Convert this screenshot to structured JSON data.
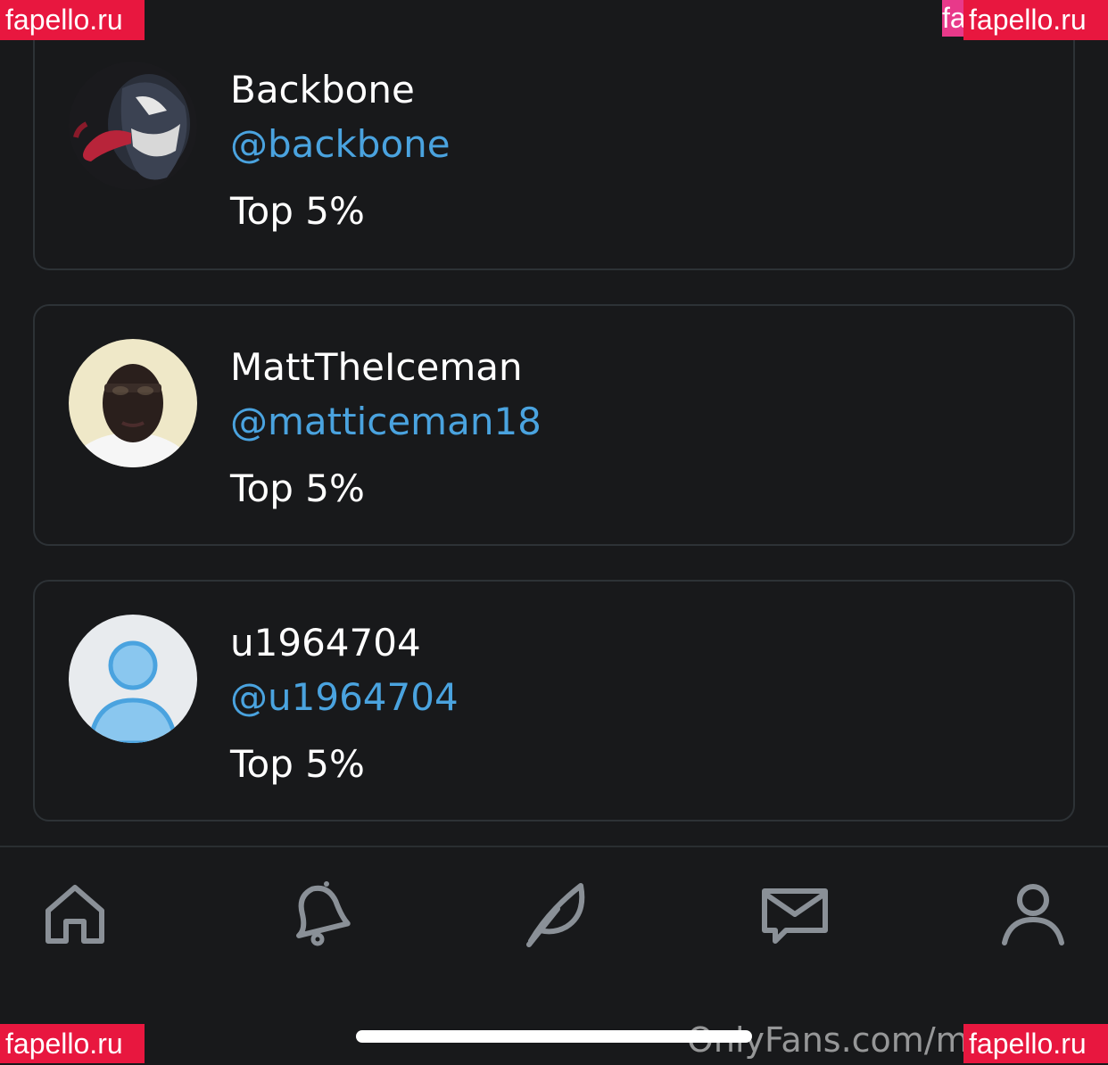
{
  "colors": {
    "background": "#18191b",
    "card_border": "#2d3236",
    "handle_blue": "#4aa3df",
    "icon_gray": "#8a9097",
    "watermark_red": "#e8173f"
  },
  "users": [
    {
      "name": "Backbone",
      "handle": "@backbone",
      "rank": "Top 5%",
      "avatar": "venom-avatar"
    },
    {
      "name": "MattTheIceman",
      "handle": "@matticeman18",
      "rank": "Top 5%",
      "avatar": "photo-avatar"
    },
    {
      "name": "u1964704",
      "handle": "@u1964704",
      "rank": "Top 5%",
      "avatar": "default-user-avatar"
    }
  ],
  "bottom_nav": [
    {
      "icon": "home-icon"
    },
    {
      "icon": "bell-icon"
    },
    {
      "icon": "feather-icon"
    },
    {
      "icon": "message-icon"
    },
    {
      "icon": "profile-icon"
    }
  ],
  "watermarks": {
    "top_left": "fapello.ru",
    "top_right": "fapello.ru",
    "top_right_partial": "fa",
    "bottom_left": "fapello.ru",
    "bottom_right": "fapello.ru",
    "url": "OnlyFans.com/ms"
  }
}
